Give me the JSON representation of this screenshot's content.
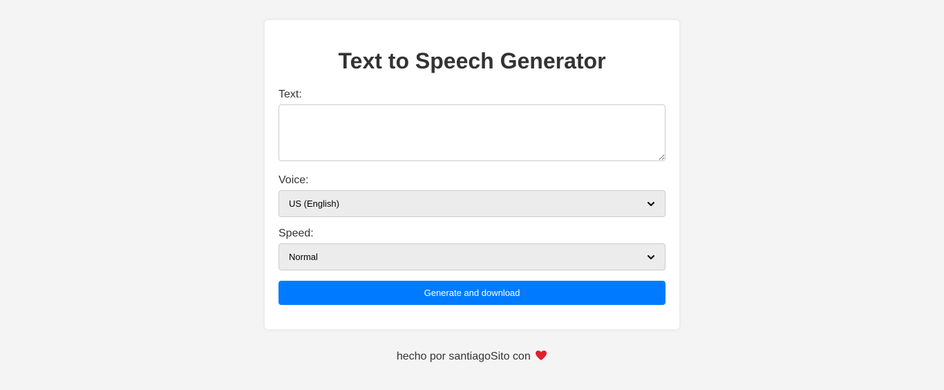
{
  "page": {
    "title": "Text to Speech Generator"
  },
  "form": {
    "text_label": "Text:",
    "text_value": "",
    "voice_label": "Voice:",
    "voice_selected": "US (English)",
    "speed_label": "Speed:",
    "speed_selected": "Normal",
    "submit_label": "Generate and download"
  },
  "footer": {
    "text": "hecho por santiagoSito con",
    "heart_icon": "heart-icon"
  },
  "colors": {
    "background": "#f4f4f4",
    "card": "#ffffff",
    "accent": "#007bff",
    "heart": "#e0202a",
    "text": "#333333"
  }
}
